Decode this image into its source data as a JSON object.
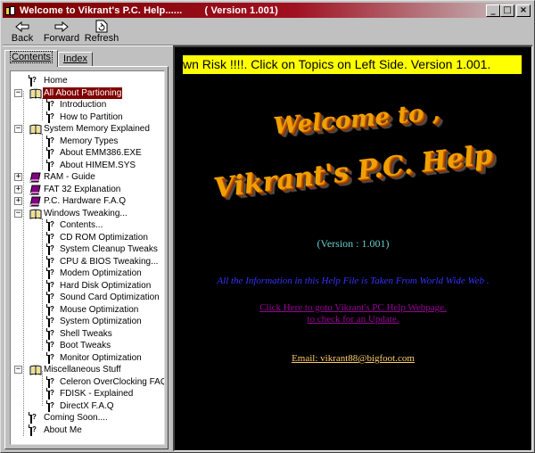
{
  "window": {
    "title": "Welcome to Vikrant's P.C. Help......        ( Version 1.001)",
    "controls": [
      "minimize",
      "maximize",
      "close"
    ]
  },
  "toolbar": {
    "back_label": "Back",
    "forward_label": "Forward",
    "refresh_label": "Refresh"
  },
  "tabs": {
    "contents_label": "Contents",
    "index_label": "Index"
  },
  "tree": {
    "home": "Home",
    "partitioning": "All About Partioning",
    "introduction": "Introduction",
    "how_to_partition": "How to Partition",
    "system_memory": "System Memory Explained",
    "memory_types": "Memory Types",
    "about_emm386": "About EMM386.EXE",
    "about_himem": "About HIMEM.SYS",
    "ram_guide": "RAM - Guide",
    "fat32": "FAT 32 Explanation",
    "pc_hardware_faq": "P.C. Hardware F.A.Q",
    "windows_tweaking": "Windows Tweaking...",
    "contents": "Contents...",
    "cdrom_opt": "CD ROM Optimization",
    "system_cleanup": "System Cleanup Tweaks",
    "cpu_bios": "CPU & BIOS Tweaking...",
    "modem_opt": "Modem Optimization",
    "hard_disk_opt": "Hard Disk Optimization",
    "sound_card_opt": "Sound Card Optimization",
    "mouse_opt": "Mouse Optimization",
    "system_opt": "System Optimization",
    "shell_tweaks": "Shell Tweaks",
    "boot_tweaks": "Boot Tweaks",
    "monitor_opt": "Monitor Optimization",
    "misc_stuff": "Miscellaneous Stuff",
    "celeron_faq": "Celeron OverClocking FAQ",
    "fdisk": "FDISK - Explained",
    "directx_faq": "DirectX F.A.Q",
    "coming_soon": "Coming Soon....",
    "about_me": "About Me"
  },
  "content": {
    "marquee": "wn Risk !!!!.     Click on Topics on Left Side.   Version 1.001.",
    "welcome_line1": "Welcome to ,",
    "welcome_line2": "Vikrant's P.C. Help",
    "version": "(Version : 1.001)",
    "info": "All the Information in this Help File is Taken From World Wide Web .",
    "link_line1": "Click Here to goto Vikrant's PC Help Webpage.",
    "link_line2": "to check for an Update.",
    "email": "Email: vikrant88@bigfoot.com"
  },
  "colors": {
    "title_bar": "#7b0000",
    "selection": "#800000",
    "content_background": "#000000",
    "marquee_background": "#ffff00",
    "welcome_text": "#f0a000",
    "version_text": "#66cccc",
    "info_text": "#3333ff",
    "link_text": "#990099",
    "email_text": "#ffcc66"
  }
}
